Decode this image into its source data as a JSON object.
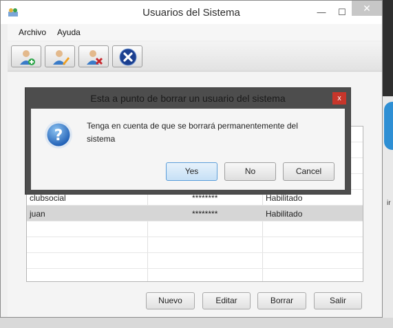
{
  "window": {
    "title": "Usuarios del Sistema",
    "minimize": "—",
    "maximize": "☐",
    "close": "✕"
  },
  "menu": [
    "Archivo",
    "Ayuda"
  ],
  "toolbar": {
    "buttons": [
      "add-user-icon",
      "edit-user-icon",
      "delete-user-icon",
      "exit-icon"
    ]
  },
  "table": {
    "rows": [
      {
        "user": "clubsocial",
        "password": "********",
        "status": "Habilitado",
        "selected": false
      },
      {
        "user": "juan",
        "password": "********",
        "status": "Habilitado",
        "selected": true
      }
    ]
  },
  "actions": {
    "new": "Nuevo",
    "edit": "Editar",
    "delete": "Borrar",
    "exit": "Salir"
  },
  "dialog": {
    "title": "Esta a punto de borrar un usuario del sistema",
    "close": "x",
    "message": "Tenga en cuenta de que se borrará permanentemente del sistema",
    "yes": "Yes",
    "no": "No",
    "cancel": "Cancel"
  },
  "colors": {
    "accent": "#5b9dd9",
    "close_red": "#c7362b",
    "dialog_frame": "#4d4d4d"
  }
}
